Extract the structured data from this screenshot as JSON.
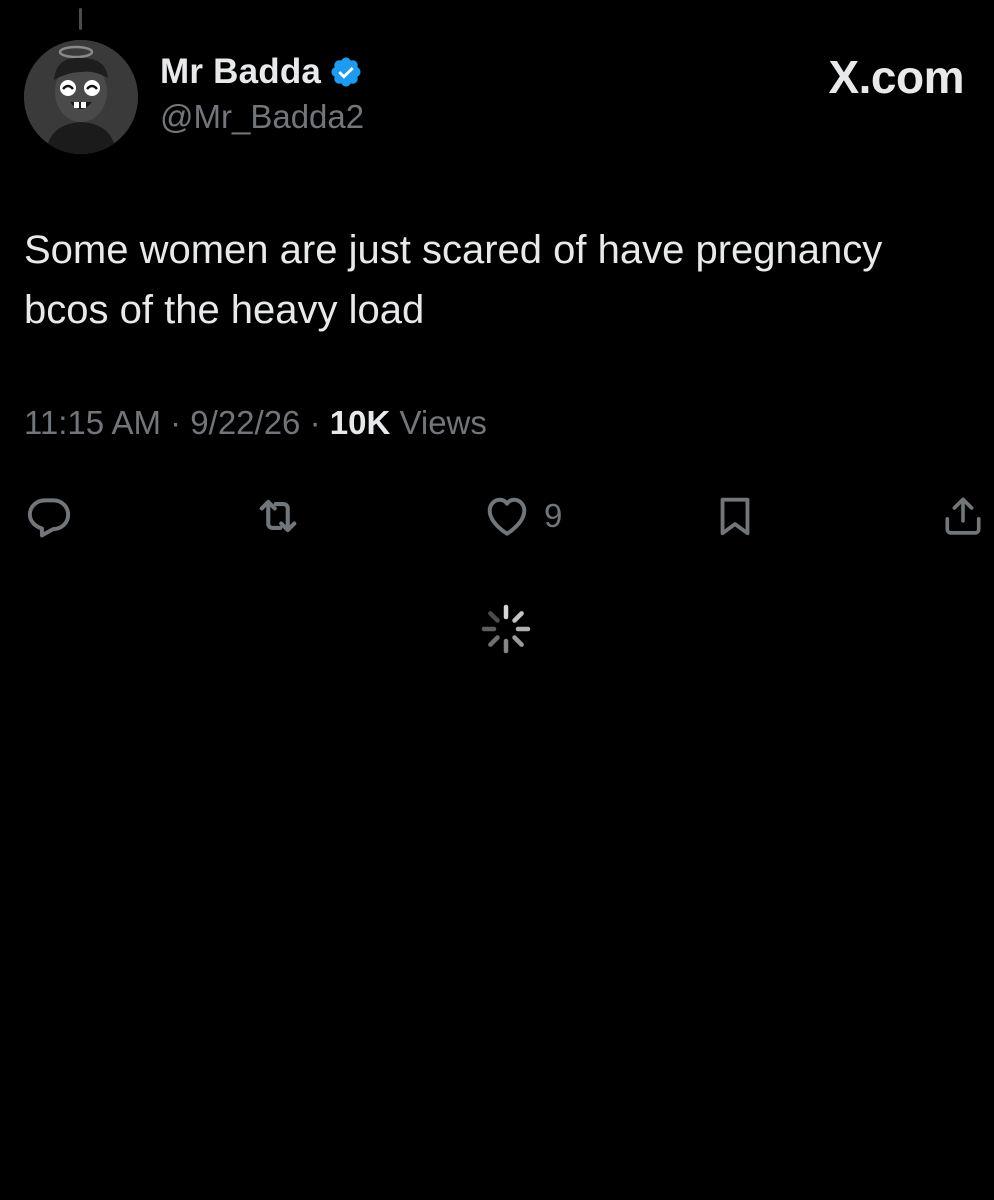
{
  "post": {
    "author": {
      "display_name": "Mr Badda",
      "handle": "@Mr_Badda2",
      "verified": true
    },
    "brand": "X.com",
    "text": "Some women are just scared of have pregnancy bcos of the heavy load",
    "timestamp": "11:15 AM · 9/22/26 · ",
    "views_count": "10K",
    "views_label": " Views"
  },
  "actions": {
    "reply": {
      "icon": "reply-icon",
      "count": ""
    },
    "repost": {
      "icon": "repost-icon",
      "count": ""
    },
    "like": {
      "icon": "heart-icon",
      "count": "9"
    },
    "bookmark": {
      "icon": "bookmark-icon",
      "count": ""
    },
    "share": {
      "icon": "share-icon",
      "count": ""
    }
  },
  "loading": {
    "icon": "loading-spinner-icon"
  },
  "colors": {
    "background": "#000000",
    "text_primary": "#e7e9ea",
    "text_secondary": "#71767b",
    "verified_badge": "#1d9bf0"
  }
}
